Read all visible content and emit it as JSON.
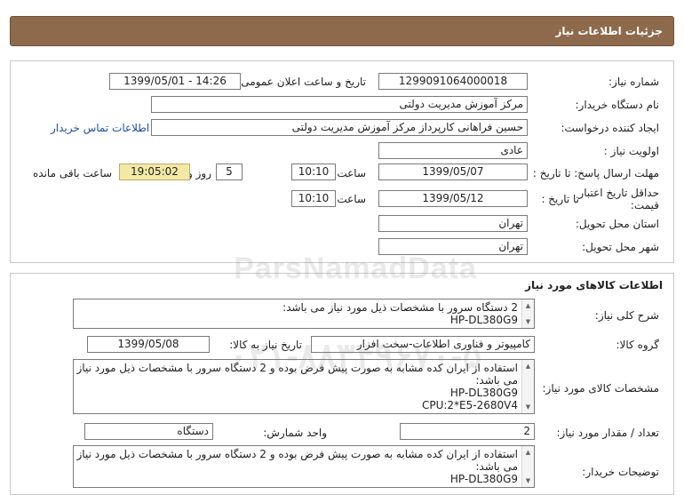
{
  "header": {
    "title": "جزئیات اطلاعات نیاز"
  },
  "info": {
    "need_number_label": "شماره نیاز:",
    "need_number": "1299091064000018",
    "announce_label": "تاریخ و ساعت اعلان عمومی:",
    "announce_value": "1399/05/01 - 14:26",
    "buyer_org_label": "نام دستگاه خریدار:",
    "buyer_org": "مرکز آموزش مدیریت دولتی",
    "requester_label": "ایجاد کننده درخواست:",
    "requester": "حسین  فراهانی کارپرداز مرکز آموزش مدیریت دولتی",
    "contact_link": "اطلاعات تماس خریدار",
    "priority_label": "اولویت نیاز :",
    "priority": "عادی",
    "deadline_label": "مهلت ارسال پاسخ:  تا تاریخ :",
    "deadline_date": "1399/05/07",
    "time_label": "ساعت",
    "deadline_time": "10:10",
    "days_value": "5",
    "days_label": "روز و",
    "remaining_time": "19:05:02",
    "remaining_label": "ساعت باقی مانده",
    "validity_label_1": "حداقل تاریخ اعتبار",
    "validity_label_2": "قیمت:",
    "validity_to_label": "تا تاریخ :",
    "validity_date": "1399/05/12",
    "validity_time": "10:10",
    "province_label": "استان محل تحویل:",
    "province": "تهران",
    "city_label": "شهر محل تحویل:",
    "city": "تهران"
  },
  "goods": {
    "section_title": "اطلاعات کالاهای مورد نیاز",
    "summary_label": "شرح کلی نیاز:",
    "summary_lines": [
      "2 دستگاه سرور با مشخصات ذیل مورد نیاز می باشد:",
      "HP-DL380G9"
    ],
    "group_label": "گروه کالا:",
    "group_value": "کامپیوتر و فناوری اطلاعات-سخت افزار",
    "need_date_label": "تاریخ نیاز به کالا:",
    "need_date": "1399/05/08",
    "specs_label": "مشخصات کالای مورد نیاز:",
    "specs_lines": [
      "استفاده از ایران کده مشابه به صورت پیش فرض بوده و 2 دستگاه سرور با مشخصات ذیل مورد نیاز",
      "می باشد:",
      "HP-DL380G9",
      "CPU:2*E5-2680V4"
    ],
    "quantity_label": "تعداد / مقدار مورد نیاز:",
    "quantity": "2",
    "unit_label": "واحد شمارش:",
    "unit": "دستگاه",
    "buyer_notes_label": "توضیحات خریدار:",
    "buyer_notes_lines": [
      "استفاده از ایران کده مشابه به صورت پیش فرض بوده و 2 دستگاه سرور با مشخصات ذیل مورد نیاز",
      "می باشد:",
      "HP-DL380G9"
    ]
  },
  "watermark": {
    "text": "ParsNamadData",
    "phone": "۰۲۱-۸۸۳۴۹۶۷۰-۵"
  }
}
